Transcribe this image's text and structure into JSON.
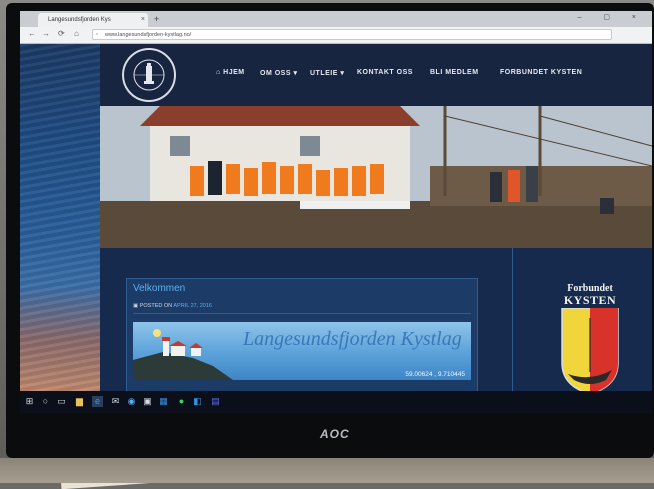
{
  "browser": {
    "tab_title": "Langesundsfjorden Kys",
    "url": "www.langesundsfjorden-kystlag.no/",
    "tab_close": "×",
    "newtab": "+",
    "nav_back": "←",
    "nav_forward": "→",
    "nav_refresh": "⟳",
    "nav_home": "⌂",
    "win_controls": "– ▢ ×"
  },
  "site": {
    "nav": [
      {
        "label": "⌂ HJEM"
      },
      {
        "label": "OM OSS ▾"
      },
      {
        "label": "UTLEIE ▾"
      },
      {
        "label": "KONTAKT OSS"
      },
      {
        "label": "BLI MEDLEM"
      },
      {
        "label": "FORBUNDET KYSTEN"
      }
    ],
    "post": {
      "title": "Velkommen",
      "posted_prefix": "▣ POSTED ON",
      "posted_date": "APRIL 27, 2016",
      "banner_title": "Langesundsfjorden Kystlag",
      "coords": "59.00624 , 9.710445"
    },
    "sidebar": {
      "logo_top": "Forbundet",
      "logo_big": "KYSTEN"
    }
  },
  "taskbar": {
    "icons": [
      "windows-icon",
      "search-icon",
      "task-view-icon",
      "file-explorer-icon",
      "edge-icon",
      "mail-icon",
      "store-icon",
      "photos-icon",
      "word-icon",
      "spotify-icon",
      "outlook-icon",
      "teams-icon"
    ]
  },
  "monitor": {
    "brand": "AOC"
  },
  "colors": {
    "accent": "#5ab2ef",
    "header": "#172540",
    "page_bg": "#0f2038"
  }
}
